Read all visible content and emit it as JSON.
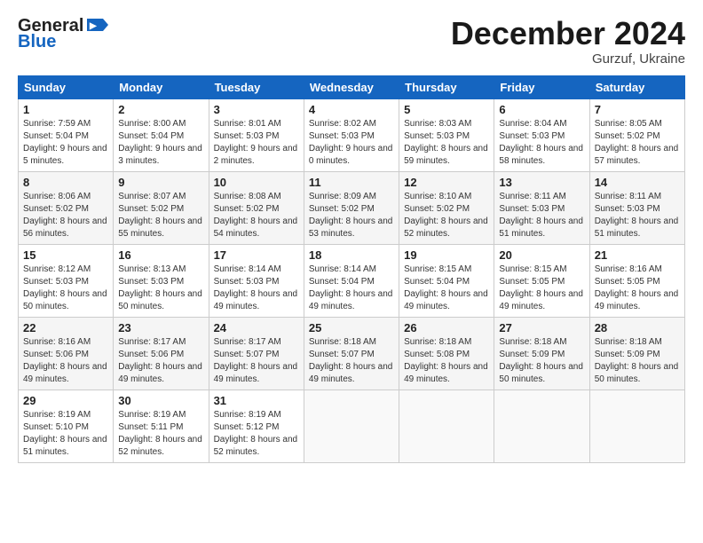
{
  "header": {
    "logo_general": "General",
    "logo_blue": "Blue",
    "month_title": "December 2024",
    "subtitle": "Gurzuf, Ukraine"
  },
  "days_of_week": [
    "Sunday",
    "Monday",
    "Tuesday",
    "Wednesday",
    "Thursday",
    "Friday",
    "Saturday"
  ],
  "weeks": [
    [
      {
        "day": 1,
        "sunrise": "7:59 AM",
        "sunset": "5:04 PM",
        "daylight": "9 hours and 5 minutes."
      },
      {
        "day": 2,
        "sunrise": "8:00 AM",
        "sunset": "5:04 PM",
        "daylight": "9 hours and 3 minutes."
      },
      {
        "day": 3,
        "sunrise": "8:01 AM",
        "sunset": "5:03 PM",
        "daylight": "9 hours and 2 minutes."
      },
      {
        "day": 4,
        "sunrise": "8:02 AM",
        "sunset": "5:03 PM",
        "daylight": "9 hours and 0 minutes."
      },
      {
        "day": 5,
        "sunrise": "8:03 AM",
        "sunset": "5:03 PM",
        "daylight": "8 hours and 59 minutes."
      },
      {
        "day": 6,
        "sunrise": "8:04 AM",
        "sunset": "5:03 PM",
        "daylight": "8 hours and 58 minutes."
      },
      {
        "day": 7,
        "sunrise": "8:05 AM",
        "sunset": "5:02 PM",
        "daylight": "8 hours and 57 minutes."
      }
    ],
    [
      {
        "day": 8,
        "sunrise": "8:06 AM",
        "sunset": "5:02 PM",
        "daylight": "8 hours and 56 minutes."
      },
      {
        "day": 9,
        "sunrise": "8:07 AM",
        "sunset": "5:02 PM",
        "daylight": "8 hours and 55 minutes."
      },
      {
        "day": 10,
        "sunrise": "8:08 AM",
        "sunset": "5:02 PM",
        "daylight": "8 hours and 54 minutes."
      },
      {
        "day": 11,
        "sunrise": "8:09 AM",
        "sunset": "5:02 PM",
        "daylight": "8 hours and 53 minutes."
      },
      {
        "day": 12,
        "sunrise": "8:10 AM",
        "sunset": "5:02 PM",
        "daylight": "8 hours and 52 minutes."
      },
      {
        "day": 13,
        "sunrise": "8:11 AM",
        "sunset": "5:03 PM",
        "daylight": "8 hours and 51 minutes."
      },
      {
        "day": 14,
        "sunrise": "8:11 AM",
        "sunset": "5:03 PM",
        "daylight": "8 hours and 51 minutes."
      }
    ],
    [
      {
        "day": 15,
        "sunrise": "8:12 AM",
        "sunset": "5:03 PM",
        "daylight": "8 hours and 50 minutes."
      },
      {
        "day": 16,
        "sunrise": "8:13 AM",
        "sunset": "5:03 PM",
        "daylight": "8 hours and 50 minutes."
      },
      {
        "day": 17,
        "sunrise": "8:14 AM",
        "sunset": "5:03 PM",
        "daylight": "8 hours and 49 minutes."
      },
      {
        "day": 18,
        "sunrise": "8:14 AM",
        "sunset": "5:04 PM",
        "daylight": "8 hours and 49 minutes."
      },
      {
        "day": 19,
        "sunrise": "8:15 AM",
        "sunset": "5:04 PM",
        "daylight": "8 hours and 49 minutes."
      },
      {
        "day": 20,
        "sunrise": "8:15 AM",
        "sunset": "5:05 PM",
        "daylight": "8 hours and 49 minutes."
      },
      {
        "day": 21,
        "sunrise": "8:16 AM",
        "sunset": "5:05 PM",
        "daylight": "8 hours and 49 minutes."
      }
    ],
    [
      {
        "day": 22,
        "sunrise": "8:16 AM",
        "sunset": "5:06 PM",
        "daylight": "8 hours and 49 minutes."
      },
      {
        "day": 23,
        "sunrise": "8:17 AM",
        "sunset": "5:06 PM",
        "daylight": "8 hours and 49 minutes."
      },
      {
        "day": 24,
        "sunrise": "8:17 AM",
        "sunset": "5:07 PM",
        "daylight": "8 hours and 49 minutes."
      },
      {
        "day": 25,
        "sunrise": "8:18 AM",
        "sunset": "5:07 PM",
        "daylight": "8 hours and 49 minutes."
      },
      {
        "day": 26,
        "sunrise": "8:18 AM",
        "sunset": "5:08 PM",
        "daylight": "8 hours and 49 minutes."
      },
      {
        "day": 27,
        "sunrise": "8:18 AM",
        "sunset": "5:09 PM",
        "daylight": "8 hours and 50 minutes."
      },
      {
        "day": 28,
        "sunrise": "8:18 AM",
        "sunset": "5:09 PM",
        "daylight": "8 hours and 50 minutes."
      }
    ],
    [
      {
        "day": 29,
        "sunrise": "8:19 AM",
        "sunset": "5:10 PM",
        "daylight": "8 hours and 51 minutes."
      },
      {
        "day": 30,
        "sunrise": "8:19 AM",
        "sunset": "5:11 PM",
        "daylight": "8 hours and 52 minutes."
      },
      {
        "day": 31,
        "sunrise": "8:19 AM",
        "sunset": "5:12 PM",
        "daylight": "8 hours and 52 minutes."
      },
      null,
      null,
      null,
      null
    ]
  ]
}
